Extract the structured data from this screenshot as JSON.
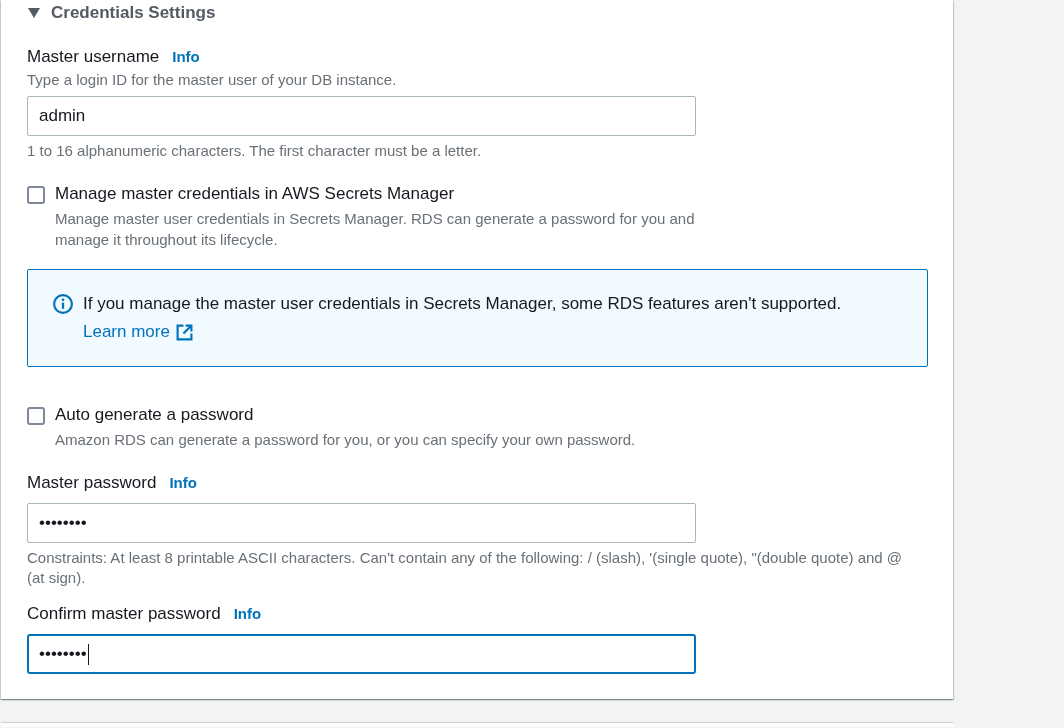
{
  "section": {
    "title": "Credentials Settings",
    "expanded": true
  },
  "items": [
    {
      "kind": "input",
      "label": "Master username",
      "info": "Info",
      "description": "Type a login ID for the master user of your DB instance.",
      "value": "admin",
      "hint": "1 to 16 alphanumeric characters. The first character must be a letter.",
      "focused": false
    },
    {
      "kind": "checkbox",
      "label": "Manage master credentials in AWS Secrets Manager",
      "description": "Manage master user credentials in Secrets Manager. RDS can generate a password for you and manage it throughout its lifecycle.",
      "checked": false
    },
    {
      "kind": "alert",
      "text": "If you manage the master user credentials in Secrets Manager, some RDS features aren't supported.",
      "link": "Learn more"
    },
    {
      "kind": "checkbox",
      "label": "Auto generate a password",
      "description": "Amazon RDS can generate a password for you, or you can specify your own password.",
      "checked": false
    },
    {
      "kind": "input",
      "label": "Master password",
      "info": "Info",
      "value": "••••••••",
      "hint": "Constraints: At least 8 printable ASCII characters. Can't contain any of the following: / (slash), '(single quote), \"(double quote) and @ (at sign).",
      "focused": false
    },
    {
      "kind": "input",
      "label": "Confirm master password",
      "info": "Info",
      "value": "••••••••",
      "focused": true
    }
  ]
}
